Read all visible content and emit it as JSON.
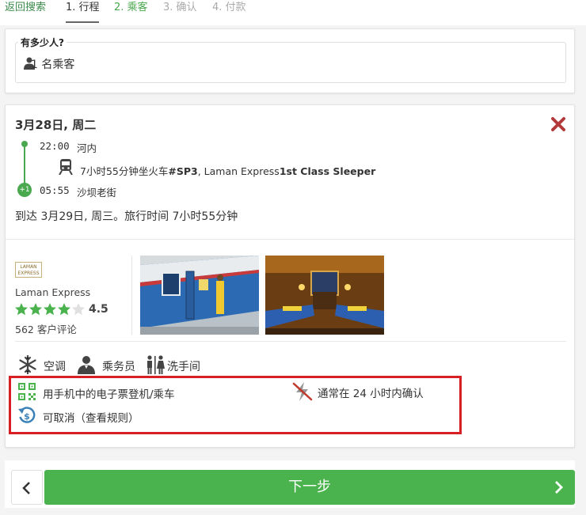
{
  "nav": {
    "back_label": "返回搜索",
    "steps": [
      "1. 行程",
      "2. 乘客",
      "3. 确认",
      "4. 付款"
    ]
  },
  "passengers": {
    "label": "有多少人?",
    "value": "1 名乘客"
  },
  "trip": {
    "date": "3月28日, 周二",
    "departure": {
      "time": "22:00",
      "place": "河内"
    },
    "train": {
      "desc_prefix": "7小时55分钟坐火车",
      "code": "#SP3",
      "operator_sep": ", Laman Express",
      "class": "1st Class Sleeper"
    },
    "arrival": {
      "time": "05:55",
      "place": "沙坝老街",
      "day_offset": "+1"
    },
    "summary": "到达 3月29日, 周三。旅行时间 7小时55分钟"
  },
  "operator": {
    "logo_text": "LAMAN EXPRESS",
    "name": "Laman Express",
    "rating": "4.5",
    "stars": 4.5,
    "reviews": "562 客户评论"
  },
  "amenities": [
    "空调",
    "乘务员",
    "洗手间"
  ],
  "features": {
    "eticket": "用手机中的电子票登机/乘车",
    "confirm": "通常在 24 小时内确认",
    "cancel": "可取消（查看规则）"
  },
  "footer": {
    "next_label": "下一步"
  },
  "colors": {
    "accent_green": "#4ab34e",
    "highlight_red": "#d81f26",
    "close_red": "#b33a3a"
  }
}
